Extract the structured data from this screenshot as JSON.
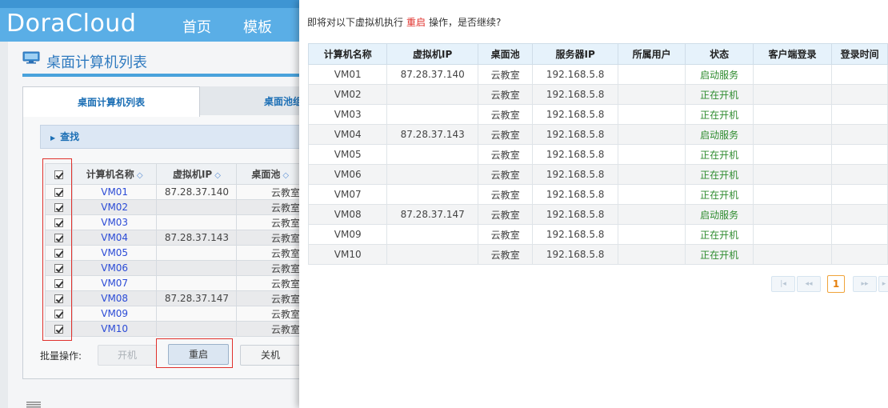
{
  "app": {
    "logo": "DoraCloud",
    "nav": {
      "home": "首页",
      "template": "模板"
    },
    "page_title": "桌面计算机列表",
    "tabs": {
      "active": "桌面计算机列表",
      "inactive": "桌面池组"
    },
    "search_label": "查找",
    "columns": {
      "name": "计算机名称",
      "ip": "虚拟机IP",
      "pool": "桌面池"
    },
    "rows": [
      {
        "name": "VM01",
        "ip": "87.28.37.140",
        "pool": "云教室"
      },
      {
        "name": "VM02",
        "ip": "",
        "pool": "云教室"
      },
      {
        "name": "VM03",
        "ip": "",
        "pool": "云教室"
      },
      {
        "name": "VM04",
        "ip": "87.28.37.143",
        "pool": "云教室"
      },
      {
        "name": "VM05",
        "ip": "",
        "pool": "云教室"
      },
      {
        "name": "VM06",
        "ip": "",
        "pool": "云教室"
      },
      {
        "name": "VM07",
        "ip": "",
        "pool": "云教室"
      },
      {
        "name": "VM08",
        "ip": "87.28.37.147",
        "pool": "云教室"
      },
      {
        "name": "VM09",
        "ip": "",
        "pool": "云教室"
      },
      {
        "name": "VM10",
        "ip": "",
        "pool": "云教室"
      }
    ],
    "batch_label": "批量操作:",
    "buttons": {
      "start": "开机",
      "reboot": "重启",
      "shutdown": "关机"
    }
  },
  "dialog": {
    "message_prefix": "即将对以下虚拟机执行",
    "message_action": "重启",
    "message_suffix": "操作，是否继续?",
    "columns": [
      "计算机名称",
      "虚拟机IP",
      "桌面池",
      "服务器IP",
      "所属用户",
      "状态",
      "客户端登录",
      "登录时间"
    ],
    "rows": [
      {
        "name": "VM01",
        "ip": "87.28.37.140",
        "pool": "云教室",
        "server_ip": "192.168.5.8",
        "user": "",
        "status": "启动服务",
        "client": "",
        "login_time": ""
      },
      {
        "name": "VM02",
        "ip": "",
        "pool": "云教室",
        "server_ip": "192.168.5.8",
        "user": "",
        "status": "正在开机",
        "client": "",
        "login_time": ""
      },
      {
        "name": "VM03",
        "ip": "",
        "pool": "云教室",
        "server_ip": "192.168.5.8",
        "user": "",
        "status": "正在开机",
        "client": "",
        "login_time": ""
      },
      {
        "name": "VM04",
        "ip": "87.28.37.143",
        "pool": "云教室",
        "server_ip": "192.168.5.8",
        "user": "",
        "status": "启动服务",
        "client": "",
        "login_time": ""
      },
      {
        "name": "VM05",
        "ip": "",
        "pool": "云教室",
        "server_ip": "192.168.5.8",
        "user": "",
        "status": "正在开机",
        "client": "",
        "login_time": ""
      },
      {
        "name": "VM06",
        "ip": "",
        "pool": "云教室",
        "server_ip": "192.168.5.8",
        "user": "",
        "status": "正在开机",
        "client": "",
        "login_time": ""
      },
      {
        "name": "VM07",
        "ip": "",
        "pool": "云教室",
        "server_ip": "192.168.5.8",
        "user": "",
        "status": "正在开机",
        "client": "",
        "login_time": ""
      },
      {
        "name": "VM08",
        "ip": "87.28.37.147",
        "pool": "云教室",
        "server_ip": "192.168.5.8",
        "user": "",
        "status": "启动服务",
        "client": "",
        "login_time": ""
      },
      {
        "name": "VM09",
        "ip": "",
        "pool": "云教室",
        "server_ip": "192.168.5.8",
        "user": "",
        "status": "正在开机",
        "client": "",
        "login_time": ""
      },
      {
        "name": "VM10",
        "ip": "",
        "pool": "云教室",
        "server_ip": "192.168.5.8",
        "user": "",
        "status": "正在开机",
        "client": "",
        "login_time": ""
      }
    ],
    "pager": {
      "current": "1",
      "first_icon": "first-page-icon",
      "prev_icon": "prev-page-icon",
      "next_icon": "next-page-icon",
      "last_icon": "last-page-icon"
    }
  },
  "colors": {
    "header_blue": "#5aaee6",
    "highlight_red": "#e0312c",
    "status_green": "#2e8b2e",
    "link_blue": "#2b4bd6",
    "pager_orange": "#e57f0b"
  }
}
